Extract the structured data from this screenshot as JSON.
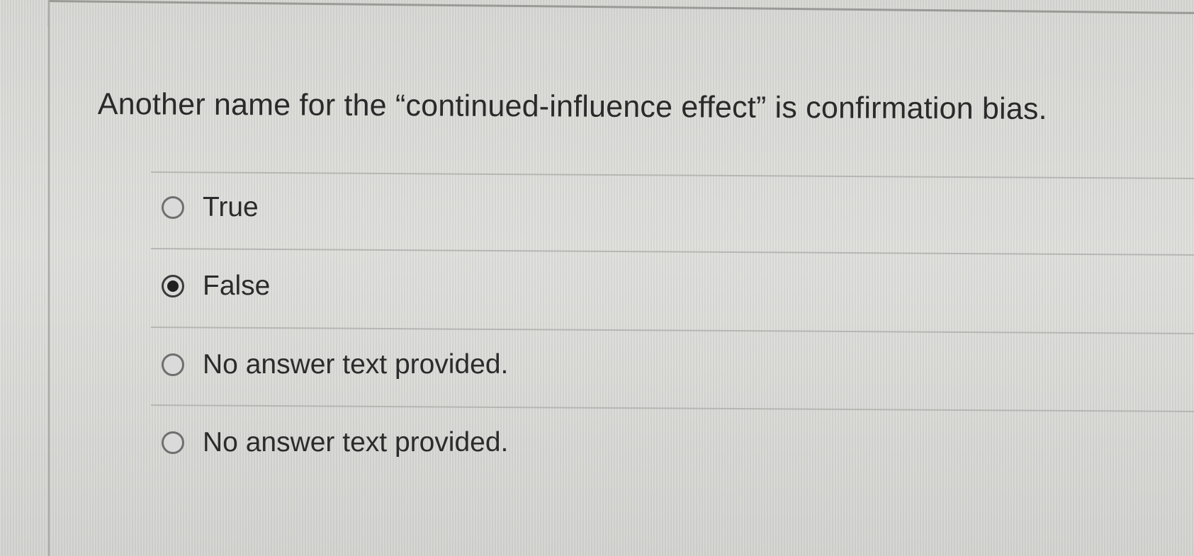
{
  "question": {
    "text": "Another name for the “continued-influence effect” is confirmation bias."
  },
  "answers": [
    {
      "label": "True",
      "selected": false
    },
    {
      "label": "False",
      "selected": true
    },
    {
      "label": "No answer text provided.",
      "selected": false
    },
    {
      "label": "No answer text provided.",
      "selected": false
    }
  ],
  "colors": {
    "background": "#d8d8d5",
    "text": "#2b2b2b",
    "divider": "#b6b6b3",
    "radio_border": "#6f6f6f",
    "radio_fill": "#1f1f1f"
  }
}
